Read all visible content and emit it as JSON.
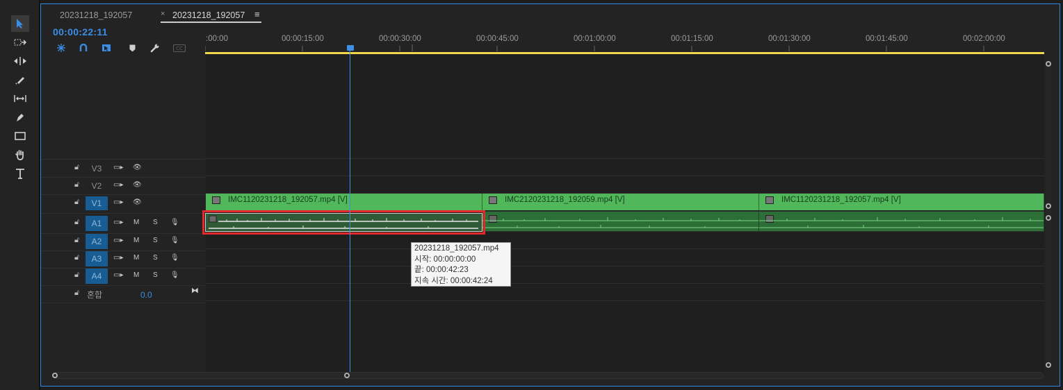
{
  "tabs": [
    {
      "label": "20231218_192057",
      "closable": false,
      "active": false
    },
    {
      "label": "20231218_192057",
      "closable": true,
      "active": true
    }
  ],
  "tab_close_glyph": "×",
  "tab_menu_glyph": "≡",
  "timecode": "00:00:22:11",
  "ruler_labels": [
    ":00:00",
    "00:00:15:00",
    "00:00:30:00",
    "00:00:45:00",
    "00:01:00:00",
    "00:01:15:00",
    "00:01:30:00",
    "00:01:45:00",
    "00:02:00:00"
  ],
  "tracks": {
    "video": [
      {
        "name": "V3",
        "targeted": false
      },
      {
        "name": "V2",
        "targeted": false
      },
      {
        "name": "V1",
        "targeted": true
      }
    ],
    "audio": [
      {
        "name": "A1",
        "targeted": true,
        "m": "M",
        "s": "S"
      },
      {
        "name": "A2",
        "targeted": true,
        "m": "M",
        "s": "S"
      },
      {
        "name": "A3",
        "targeted": true,
        "m": "M",
        "s": "S"
      },
      {
        "name": "A4",
        "targeted": true,
        "m": "M",
        "s": "S"
      }
    ],
    "mix": {
      "label": "혼합",
      "value": "0.0"
    }
  },
  "clips": {
    "video": [
      {
        "label": "IMC1120231218_192057.mp4 [V]"
      },
      {
        "label": "IMC2120231218_192059.mp4 [V]"
      },
      {
        "label": "IMC1120231218_192057.mp4 [V]"
      }
    ]
  },
  "tooltip": {
    "filename": "20231218_192057.mp4",
    "start": "시작: 00:00:00:00",
    "end": "끝: 00:00:42:23",
    "duration": "지속 시간: 00:00:42:24"
  },
  "colors": {
    "accent": "#2d8ceb",
    "video_clip": "#50b85a",
    "audio_clip": "#2b6f36",
    "selection": "#e3272a",
    "ruler_work_area": "#f0d84a",
    "track_targeted": "#175d93"
  },
  "icons": [
    "selection-tool-icon",
    "track-select-forward-icon",
    "ripple-edit-icon",
    "razor-icon",
    "slip-icon",
    "pen-icon",
    "rectangle-icon",
    "hand-icon",
    "type-icon",
    "snap-icon",
    "linked-selection-icon",
    "add-marker-icon",
    "wrench-icon",
    "captions-icon",
    "lock-icon",
    "toggle-sync-icon",
    "eye-icon",
    "microphone-icon",
    "mute-toggle",
    "solo-toggle"
  ]
}
